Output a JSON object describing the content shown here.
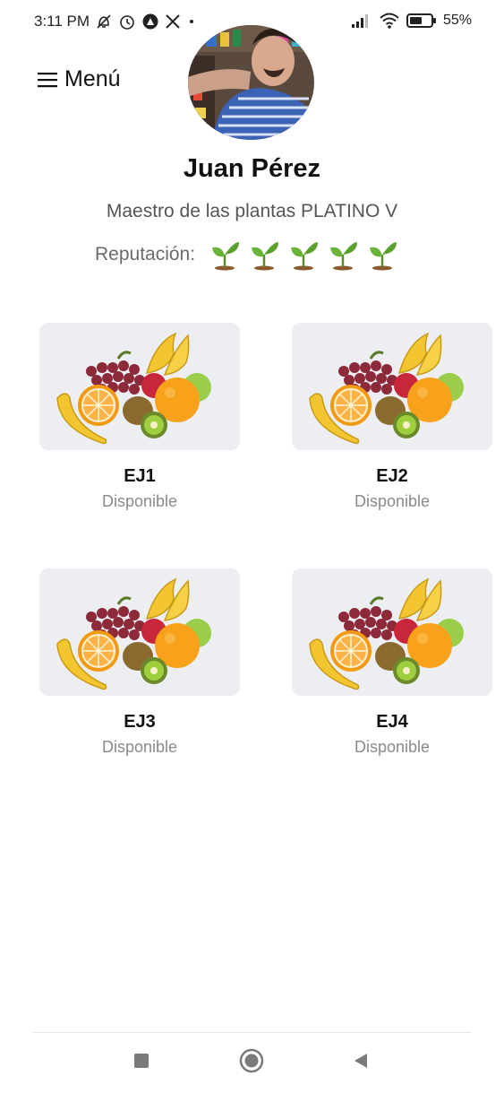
{
  "status_bar": {
    "time": "3:11 PM",
    "battery": "55%",
    "icons": [
      "mute-icon",
      "alarm-icon",
      "app-icon",
      "x-icon",
      "dot",
      "signal-icon",
      "wifi-icon",
      "battery-icon"
    ]
  },
  "header": {
    "menu_label": "Menú"
  },
  "profile": {
    "name": "Juan Pérez",
    "rank": "Maestro de las plantas PLATINO V",
    "reputation_label": "Reputación:",
    "reputation_level": 5,
    "reputation_max": 5,
    "reputation_icon": "sprout-icon"
  },
  "cards": [
    {
      "title": "EJ1",
      "status": "Disponible",
      "image": "fruit-image"
    },
    {
      "title": "EJ2",
      "status": "Disponible",
      "image": "fruit-image"
    },
    {
      "title": "EJ3",
      "status": "Disponible",
      "image": "fruit-image"
    },
    {
      "title": "EJ4",
      "status": "Disponible",
      "image": "fruit-image"
    }
  ],
  "nav": {
    "icons": [
      "recents-square-icon",
      "home-circle-icon",
      "back-triangle-icon"
    ]
  },
  "colors": {
    "background": "#ffffff",
    "text_primary": "#111111",
    "text_secondary": "#555555",
    "status_text": "#8a8a8a",
    "sprout_green": "#5aa02c",
    "card_bg": "#eceef2"
  }
}
